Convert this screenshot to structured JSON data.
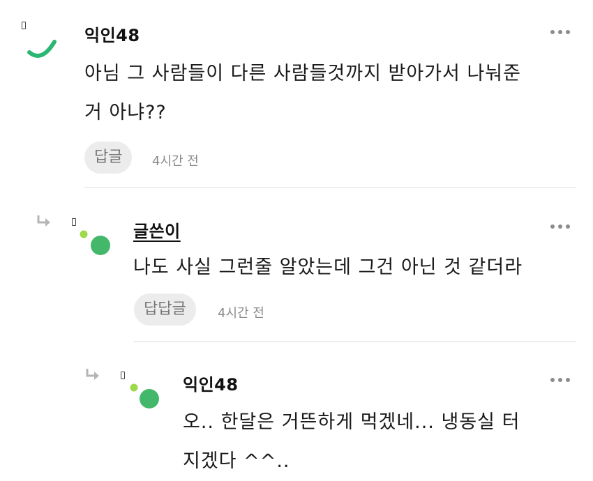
{
  "comments": [
    {
      "author": "익인48",
      "body_line1": "아님 그 사람들이 다른 사람들것까지 받아가서 나눠준",
      "body_line2": "거 아냐??",
      "reply_label": "답글",
      "time": "4시간 전"
    },
    {
      "author": "글쓴이",
      "body_line1": "나도 사실 그런줄 알았는데 그건 아닌 것 같더라",
      "reply_label": "답답글",
      "time": "4시간 전"
    },
    {
      "author": "익인48",
      "body_line1": "오.. 한달은 거뜬하게 먹겠네... 냉동실 터",
      "body_line2": "지겠다 ^^.."
    }
  ],
  "colors": {
    "accent_green": "#2bb673",
    "light_green": "#9ed94a",
    "button_bg": "#ececec",
    "time_text": "#8a8a8a"
  },
  "icons": [
    "reply-arrow-icon",
    "more-options-icon",
    "avatar-icon"
  ]
}
